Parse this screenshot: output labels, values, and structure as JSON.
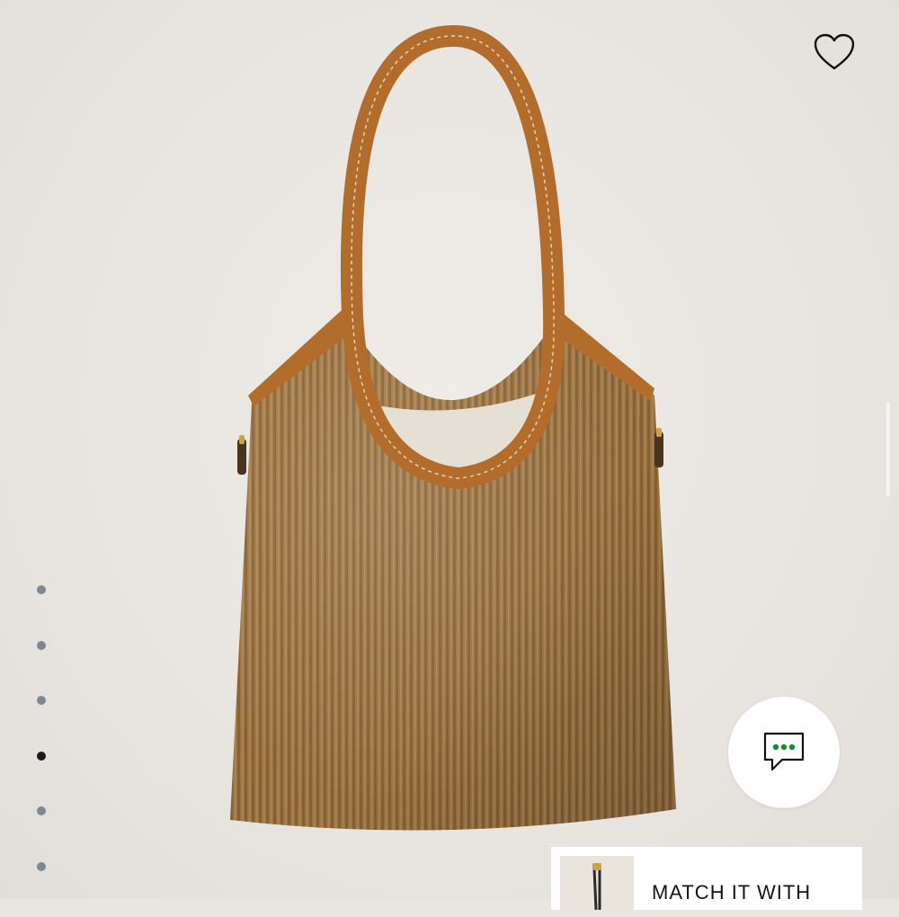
{
  "wishlist": {
    "icon": "heart-icon"
  },
  "carousel": {
    "slide_count": 6,
    "active_index": 3
  },
  "chat": {
    "icon": "chat-bubble-icon",
    "accent_color": "#1a8a2a"
  },
  "match": {
    "label": "MATCH IT WITH"
  },
  "colors": {
    "background": "#e9e6e1",
    "corduroy": "#a37a47",
    "leather_trim": "#b26d2c",
    "lining": "#e6e0d4",
    "dot_inactive": "#7f8790",
    "dot_active": "#1b1b1b"
  }
}
